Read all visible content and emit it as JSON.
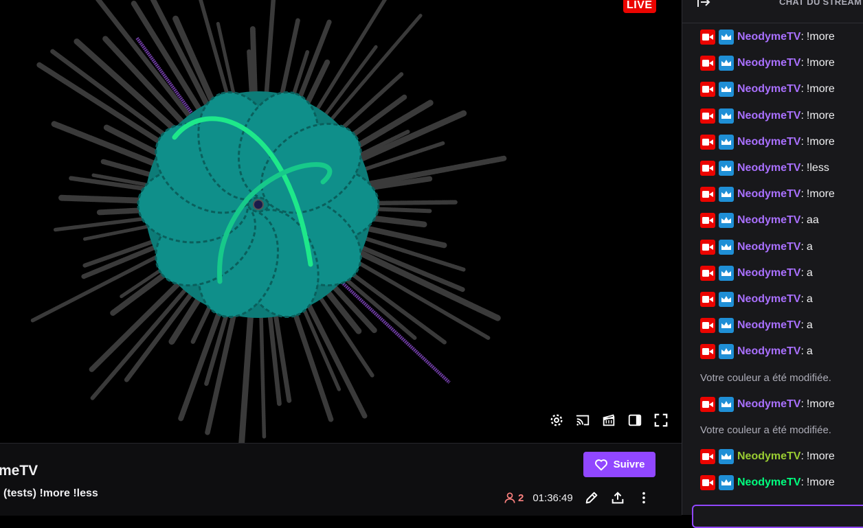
{
  "player": {
    "live_label": "LIVE"
  },
  "channel": {
    "name": "meTV",
    "title": "(tests) !more !less",
    "follow_label": "Suivre",
    "viewers": "2",
    "uptime": "01:36:49"
  },
  "chat": {
    "title": "CHAT DU STREAM",
    "messages": [
      {
        "user": "NeodymeTV",
        "text": "!more",
        "color": "#a970ff",
        "system": false
      },
      {
        "user": "NeodymeTV",
        "text": "!more",
        "color": "#a970ff",
        "system": false
      },
      {
        "user": "NeodymeTV",
        "text": "!more",
        "color": "#a970ff",
        "system": false
      },
      {
        "user": "NeodymeTV",
        "text": "!more",
        "color": "#a970ff",
        "system": false
      },
      {
        "user": "NeodymeTV",
        "text": "!more",
        "color": "#a970ff",
        "system": false
      },
      {
        "user": "NeodymeTV",
        "text": "!less",
        "color": "#a970ff",
        "system": false
      },
      {
        "user": "NeodymeTV",
        "text": "!more",
        "color": "#a970ff",
        "system": false
      },
      {
        "user": "NeodymeTV",
        "text": "aa",
        "color": "#a970ff",
        "system": false
      },
      {
        "user": "NeodymeTV",
        "text": "a",
        "color": "#a970ff",
        "system": false
      },
      {
        "user": "NeodymeTV",
        "text": "a",
        "color": "#a970ff",
        "system": false
      },
      {
        "user": "NeodymeTV",
        "text": "a",
        "color": "#a970ff",
        "system": false
      },
      {
        "user": "NeodymeTV",
        "text": "a",
        "color": "#a970ff",
        "system": false
      },
      {
        "user": "NeodymeTV",
        "text": "a",
        "color": "#a970ff",
        "system": false
      },
      {
        "system": true,
        "text": "Votre couleur a été modifiée."
      },
      {
        "user": "NeodymeTV",
        "text": "!more",
        "color": "#a970ff",
        "system": false
      },
      {
        "system": true,
        "text": "Votre couleur a été modifiée."
      },
      {
        "user": "NeodymeTV",
        "text": "!more",
        "color": "#9acd32",
        "system": false
      },
      {
        "user": "NeodymeTV",
        "text": "!more",
        "color": "#00ff7f",
        "system": false
      }
    ]
  },
  "colors": {
    "accent": "#9147ff",
    "live": "#eb0400",
    "viz_teal": "#0f8f8a",
    "viz_green": "#1ee88a",
    "spike": "#3a3a3a"
  }
}
